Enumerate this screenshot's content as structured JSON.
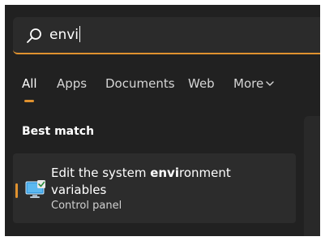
{
  "search": {
    "value": "envi"
  },
  "tabs": [
    {
      "label": "All",
      "active": true
    },
    {
      "label": "Apps",
      "active": false
    },
    {
      "label": "Documents",
      "active": false
    },
    {
      "label": "Web",
      "active": false
    },
    {
      "label": "More",
      "active": false
    }
  ],
  "best_match": {
    "heading": "Best match",
    "result": {
      "title_prefix": "Edit the system ",
      "title_highlight": "envi",
      "title_suffix": "ronment variables",
      "subtitle": "Control panel",
      "icon": "system-properties-icon"
    }
  },
  "colors": {
    "accent": "#e0922f",
    "panel_bg": "#212121",
    "item_bg": "#2c2c2c"
  }
}
